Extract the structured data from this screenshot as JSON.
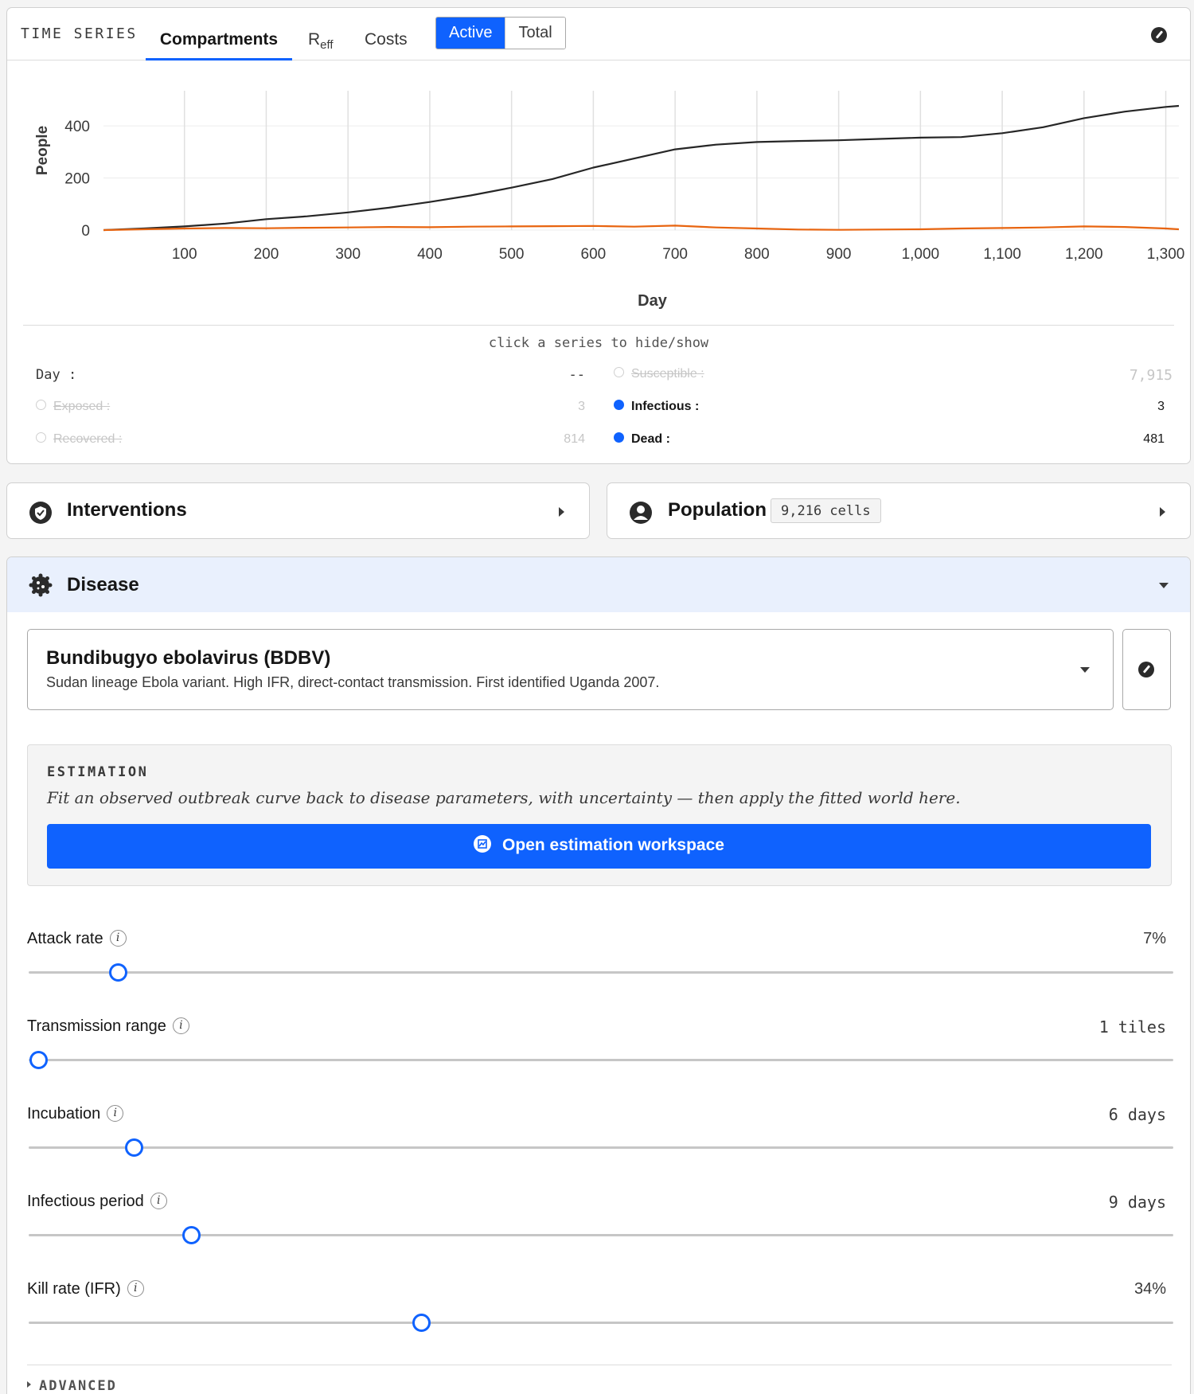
{
  "timeseries": {
    "title": "TIME SERIES",
    "tabs": [
      {
        "label": "Compartments",
        "selected": true
      },
      {
        "label_main": "R",
        "label_sub": "eff"
      },
      {
        "label": "Costs"
      }
    ],
    "segment": [
      "Active",
      "Total"
    ],
    "segment_selected": "Active",
    "legend_hint": "click a series to hide/show",
    "legend": {
      "day": {
        "label": "Day",
        "value": "--"
      },
      "susceptible": {
        "label": "Susceptible",
        "value": "7,915",
        "visible": false
      },
      "exposed": {
        "label": "Exposed",
        "value": "3",
        "visible": false
      },
      "infectious": {
        "label": "Infectious",
        "value": "3",
        "visible": true
      },
      "recovered": {
        "label": "Recovered",
        "value": "814",
        "visible": false
      },
      "dead": {
        "label": "Dead",
        "value": "481",
        "visible": true
      }
    }
  },
  "chart_data": {
    "type": "line",
    "xlabel": "Day",
    "ylabel": "People",
    "xlim": [
      1,
      1316
    ],
    "ylim": [
      0,
      480
    ],
    "xticks": [
      100,
      200,
      300,
      400,
      500,
      600,
      700,
      800,
      900,
      1000,
      1100,
      1200,
      1300
    ],
    "xtick_labels": [
      "100",
      "200",
      "300",
      "400",
      "500",
      "600",
      "700",
      "800",
      "900",
      "1,000",
      "1,100",
      "1,200",
      "1,300"
    ],
    "yticks": [
      0,
      200,
      400
    ],
    "ytick_labels": [
      "0",
      "200",
      "400"
    ],
    "grid": "vertical",
    "series": [
      {
        "name": "Dead",
        "color": "#262626",
        "x": [
          1,
          50,
          100,
          150,
          200,
          250,
          300,
          350,
          400,
          450,
          500,
          550,
          600,
          650,
          700,
          750,
          800,
          850,
          900,
          950,
          1000,
          1050,
          1100,
          1150,
          1200,
          1250,
          1300,
          1316
        ],
        "y": [
          0,
          6,
          14,
          25,
          42,
          53,
          68,
          86,
          108,
          133,
          163,
          196,
          240,
          275,
          310,
          328,
          338,
          342,
          345,
          350,
          355,
          357,
          372,
          395,
          430,
          455,
          473,
          477
        ]
      },
      {
        "name": "Infectious",
        "color": "#e8640f",
        "x": [
          1,
          50,
          100,
          150,
          200,
          250,
          300,
          350,
          400,
          450,
          500,
          550,
          600,
          650,
          700,
          750,
          800,
          850,
          900,
          950,
          1000,
          1050,
          1100,
          1150,
          1200,
          1250,
          1300,
          1316
        ],
        "y": [
          0,
          3,
          6,
          8,
          7,
          9,
          10,
          12,
          11,
          13,
          14,
          15,
          16,
          13,
          17,
          10,
          6,
          2,
          1,
          2,
          3,
          6,
          8,
          10,
          14,
          12,
          6,
          3
        ]
      }
    ]
  },
  "panels": {
    "interventions": {
      "title": "Interventions"
    },
    "population": {
      "title": "Population",
      "badge": "9,216 cells"
    }
  },
  "disease": {
    "title": "Disease",
    "selected_name": "Bundibugyo ebolavirus (BDBV)",
    "selected_desc": "Sudan lineage Ebola variant. High IFR, direct-contact transmission. First identified Uganda 2007.",
    "estimation": {
      "label": "ESTIMATION",
      "desc": "Fit an observed outbreak curve back to disease parameters, with uncertainty — then apply the fitted world here.",
      "button": "Open estimation workspace"
    },
    "params": [
      {
        "label": "Attack rate",
        "value": "7%",
        "fraction": 0.078
      },
      {
        "label": "Transmission range",
        "value": "1 tiles",
        "fraction": 0.008
      },
      {
        "label": "Incubation",
        "value": "6 days",
        "fraction": 0.092
      },
      {
        "label": "Infectious period",
        "value": "9 days",
        "fraction": 0.142
      },
      {
        "label": "Kill rate (IFR)",
        "value": "34%",
        "fraction": 0.343
      }
    ],
    "advanced": "ADVANCED"
  },
  "colors": {
    "accent": "#0f62fe",
    "infectious": "#e8640f",
    "dead": "#262626",
    "disease_header_bg": "#e9f0fd"
  },
  "icons": [
    "pencil-icon",
    "shield-check-icon",
    "person-icon",
    "virus-icon",
    "chart-icon",
    "info-icon",
    "caret-right-icon",
    "caret-down-icon"
  ]
}
